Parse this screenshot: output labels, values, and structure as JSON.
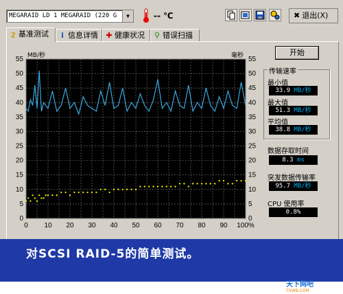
{
  "toolbar": {
    "drive_select": "MEGARAID LD  1 MEGARAID  (220 G",
    "temperature": "-- ℃",
    "exit_label": "退出(X)"
  },
  "tabs": [
    {
      "label": "基准测试"
    },
    {
      "label": "信息详情"
    },
    {
      "label": "健康状况"
    },
    {
      "label": "错误扫描"
    }
  ],
  "graph": {
    "left_unit": "MB/秒",
    "right_unit": "毫秒",
    "y_ticks": [
      "55",
      "50",
      "45",
      "40",
      "35",
      "30",
      "25",
      "20",
      "15",
      "10",
      "5",
      "0"
    ],
    "x_ticks": [
      "0",
      "10",
      "20",
      "30",
      "40",
      "50",
      "60",
      "70",
      "80",
      "90",
      "100%"
    ]
  },
  "start_button": "开始",
  "stats": {
    "group_title": "传输速率",
    "min_label": "最小值",
    "min_value": "33.9",
    "max_label": "最大值",
    "max_value": "51.3",
    "avg_label": "平均值",
    "avg_value": "38.8",
    "rate_unit": "MB/秒",
    "access_label": "数据存取时间",
    "access_value": "8.3",
    "access_unit": "ms",
    "burst_label": "突发数据传输率",
    "burst_value": "95.7",
    "cpu_label": "CPU 使用率",
    "cpu_value": "0.8%"
  },
  "caption": "对SCSI RAID-5的简单测试。",
  "watermark": {
    "brand": "天下网吧",
    "site": "TXWB.COM"
  },
  "chart_data": {
    "type": "line",
    "title": "",
    "x": [
      0,
      1,
      2,
      3,
      4,
      5,
      6,
      7,
      8,
      9,
      10,
      12,
      14,
      16,
      18,
      20,
      22,
      24,
      26,
      28,
      30,
      32,
      34,
      36,
      38,
      40,
      42,
      44,
      46,
      48,
      50,
      52,
      54,
      56,
      58,
      60,
      62,
      64,
      66,
      68,
      70,
      72,
      74,
      76,
      78,
      80,
      82,
      84,
      86,
      88,
      90,
      92,
      94,
      96,
      98,
      100
    ],
    "series": [
      {
        "values": [
          38,
          37,
          41,
          39,
          46,
          38,
          51,
          37,
          40,
          39,
          38,
          44,
          37,
          39,
          45,
          38,
          40,
          36,
          42,
          39,
          38,
          37,
          44,
          39,
          47,
          38,
          39,
          45,
          37,
          40,
          38,
          43,
          39,
          37,
          41,
          48,
          38,
          40,
          37,
          44,
          39,
          38,
          46,
          37,
          40,
          38,
          45,
          39,
          37,
          42,
          38,
          44,
          39,
          38,
          47,
          39
        ]
      },
      {
        "values": [
          6,
          7,
          6,
          8,
          7,
          6,
          8,
          7,
          7,
          8,
          8,
          8,
          8,
          9,
          9,
          8,
          9,
          9,
          9,
          9,
          9,
          9,
          10,
          10,
          9,
          10,
          10,
          10,
          10,
          10,
          10,
          11,
          11,
          11,
          11,
          11,
          11,
          11,
          11,
          11,
          12,
          12,
          11,
          12,
          12,
          12,
          12,
          12,
          12,
          13,
          13,
          12,
          12,
          13,
          13,
          13
        ]
      }
    ],
    "xlim": [
      0,
      100
    ],
    "ylim": [
      0,
      55
    ],
    "y2lim": [
      0,
      55
    ]
  }
}
